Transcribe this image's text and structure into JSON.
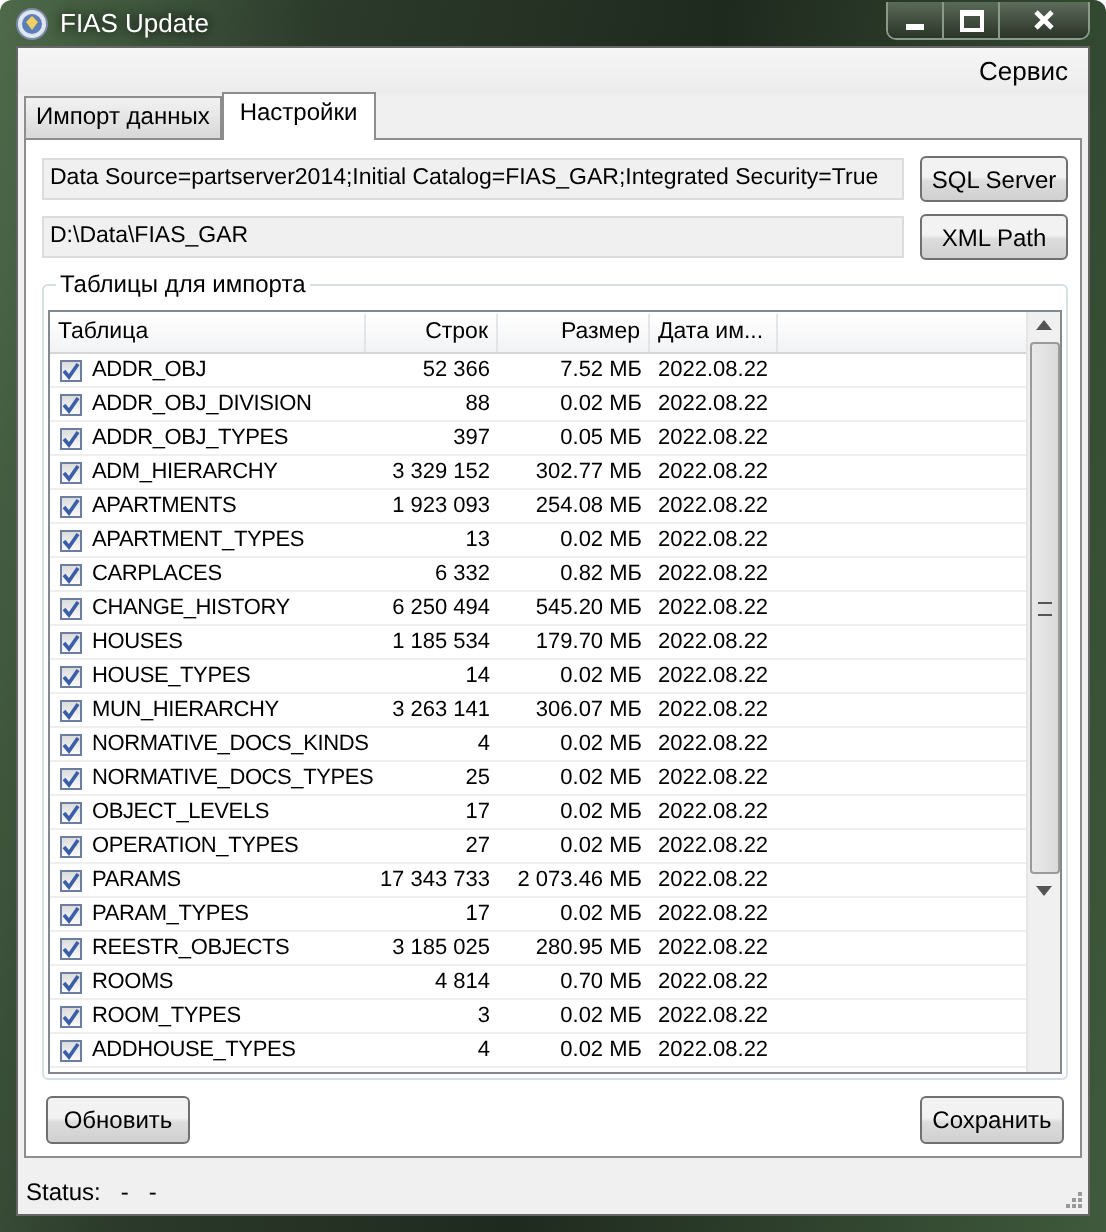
{
  "window": {
    "title": "FIAS Update"
  },
  "menu": [
    "Сервис"
  ],
  "tabs": [
    {
      "label": "Импорт данных",
      "selected": false
    },
    {
      "label": "Настройки",
      "selected": true
    }
  ],
  "settings": {
    "connection": {
      "value": "Data Source=partserver2014;Initial Catalog=FIAS_GAR;Integrated Security=True",
      "button": "SQL Server"
    },
    "xml_path": {
      "value": "D:\\Data\\FIAS_GAR",
      "button": "XML Path"
    }
  },
  "group": {
    "title": "Таблицы для импорта"
  },
  "table": {
    "columns": [
      "Таблица",
      "Строк",
      "Размер",
      "Дата им..."
    ],
    "rows": [
      {
        "checked": true,
        "name": "ADDR_OBJ",
        "rows": "52 366",
        "size": "7.52 МБ",
        "date": "2022.08.22"
      },
      {
        "checked": true,
        "name": "ADDR_OBJ_DIVISION",
        "rows": "88",
        "size": "0.02 МБ",
        "date": "2022.08.22"
      },
      {
        "checked": true,
        "name": "ADDR_OBJ_TYPES",
        "rows": "397",
        "size": "0.05 МБ",
        "date": "2022.08.22"
      },
      {
        "checked": true,
        "name": "ADM_HIERARCHY",
        "rows": "3 329 152",
        "size": "302.77 МБ",
        "date": "2022.08.22"
      },
      {
        "checked": true,
        "name": "APARTMENTS",
        "rows": "1 923 093",
        "size": "254.08 МБ",
        "date": "2022.08.22"
      },
      {
        "checked": true,
        "name": "APARTMENT_TYPES",
        "rows": "13",
        "size": "0.02 МБ",
        "date": "2022.08.22"
      },
      {
        "checked": true,
        "name": "CARPLACES",
        "rows": "6 332",
        "size": "0.82 МБ",
        "date": "2022.08.22"
      },
      {
        "checked": true,
        "name": "CHANGE_HISTORY",
        "rows": "6 250 494",
        "size": "545.20 МБ",
        "date": "2022.08.22"
      },
      {
        "checked": true,
        "name": "HOUSES",
        "rows": "1 185 534",
        "size": "179.70 МБ",
        "date": "2022.08.22"
      },
      {
        "checked": true,
        "name": "HOUSE_TYPES",
        "rows": "14",
        "size": "0.02 МБ",
        "date": "2022.08.22"
      },
      {
        "checked": true,
        "name": "MUN_HIERARCHY",
        "rows": "3 263 141",
        "size": "306.07 МБ",
        "date": "2022.08.22"
      },
      {
        "checked": true,
        "name": "NORMATIVE_DOCS_KINDS",
        "rows": "4",
        "size": "0.02 МБ",
        "date": "2022.08.22"
      },
      {
        "checked": true,
        "name": "NORMATIVE_DOCS_TYPES",
        "rows": "25",
        "size": "0.02 МБ",
        "date": "2022.08.22"
      },
      {
        "checked": true,
        "name": "OBJECT_LEVELS",
        "rows": "17",
        "size": "0.02 МБ",
        "date": "2022.08.22"
      },
      {
        "checked": true,
        "name": "OPERATION_TYPES",
        "rows": "27",
        "size": "0.02 МБ",
        "date": "2022.08.22"
      },
      {
        "checked": true,
        "name": "PARAMS",
        "rows": "17 343 733",
        "size": "2 073.46 МБ",
        "date": "2022.08.22"
      },
      {
        "checked": true,
        "name": "PARAM_TYPES",
        "rows": "17",
        "size": "0.02 МБ",
        "date": "2022.08.22"
      },
      {
        "checked": true,
        "name": "REESTR_OBJECTS",
        "rows": "3 185 025",
        "size": "280.95 МБ",
        "date": "2022.08.22"
      },
      {
        "checked": true,
        "name": "ROOMS",
        "rows": "4 814",
        "size": "0.70 МБ",
        "date": "2022.08.22"
      },
      {
        "checked": true,
        "name": "ROOM_TYPES",
        "rows": "3",
        "size": "0.02 МБ",
        "date": "2022.08.22"
      },
      {
        "checked": true,
        "name": "ADDHOUSE_TYPES",
        "rows": "4",
        "size": "0.02 МБ",
        "date": "2022.08.22"
      }
    ]
  },
  "buttons": [
    {
      "label": "Обновить"
    },
    {
      "label": "Сохранить"
    }
  ],
  "status_bar": {
    "label": "Status:",
    "values": [
      "-",
      "-"
    ]
  }
}
